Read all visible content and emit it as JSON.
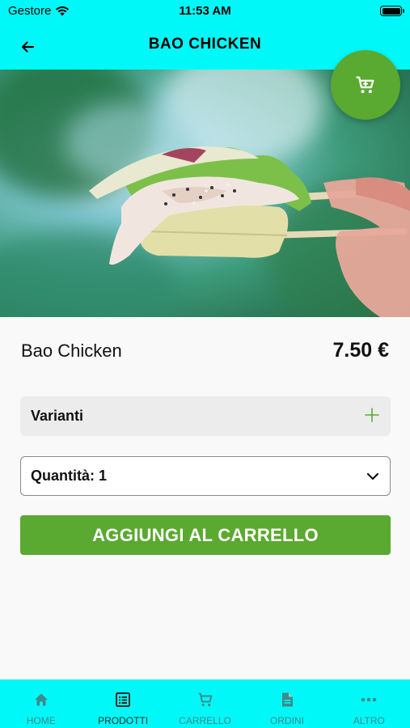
{
  "status_bar": {
    "carrier": "Gestore",
    "time": "11:53 AM"
  },
  "header": {
    "title": "BAO CHICKEN"
  },
  "product": {
    "name": "Bao Chicken",
    "price": "7.50 €"
  },
  "variants": {
    "label": "Varianti"
  },
  "quantity": {
    "label": "Quantità: 1"
  },
  "add_to_cart": {
    "label": "AGGIUNGI AL CARRELLO"
  },
  "tabs": [
    {
      "label": "HOME",
      "icon": "home-icon",
      "active": false
    },
    {
      "label": "PRODOTTI",
      "icon": "menu-list-icon",
      "active": true
    },
    {
      "label": "CARRELLO",
      "icon": "cart-icon",
      "active": false
    },
    {
      "label": "ORDINI",
      "icon": "document-icon",
      "active": false
    },
    {
      "label": "ALTRO",
      "icon": "more-icon",
      "active": false
    }
  ],
  "colors": {
    "header_bg": "#00f9f8",
    "accent_green": "#5aa930",
    "tab_inactive": "#3d8b8c",
    "tab_active": "#1d2b2b"
  }
}
